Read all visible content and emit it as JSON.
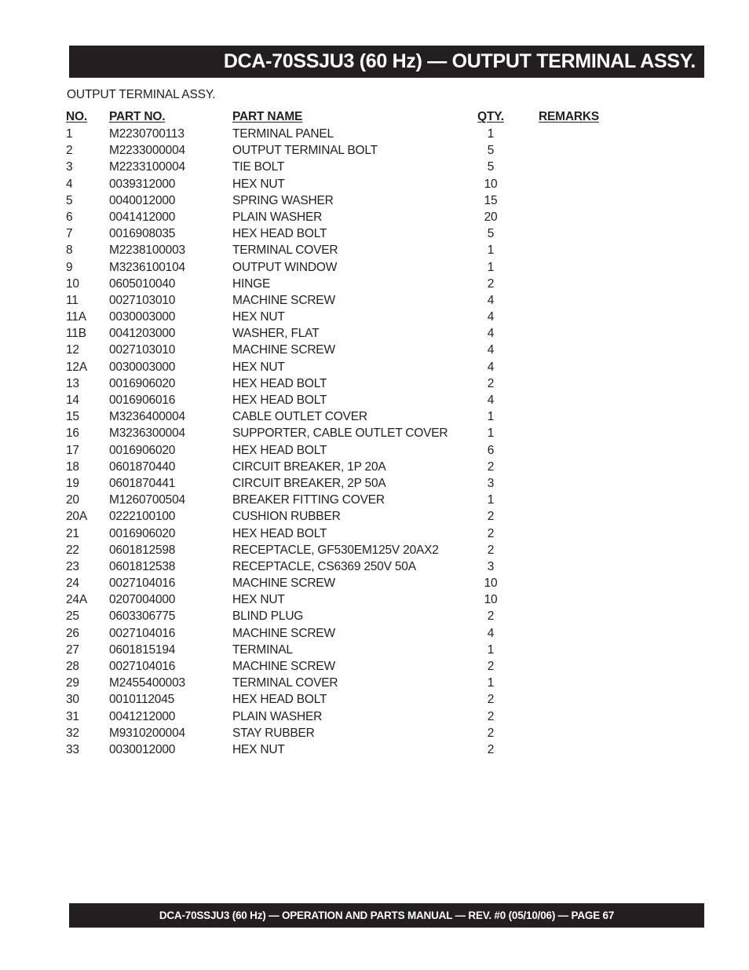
{
  "header": {
    "title": "DCA-70SSJU3 (60 Hz) — OUTPUT TERMINAL ASSY.",
    "background_color": "#231f20",
    "text_color": "#ffffff"
  },
  "section": {
    "title": "OUTPUT TERMINAL ASSY."
  },
  "table": {
    "columns": {
      "no": "NO.",
      "part_no": "PART NO.",
      "part_name": "PART NAME",
      "qty": "QTY.",
      "remarks": "REMARKS"
    },
    "rows": [
      {
        "no": "1",
        "part_no": "M2230700113",
        "part_name": "TERMINAL PANEL",
        "qty": "1",
        "remarks": ""
      },
      {
        "no": "2",
        "part_no": "M2233000004",
        "part_name": "OUTPUT TERMINAL BOLT",
        "qty": "5",
        "remarks": ""
      },
      {
        "no": "3",
        "part_no": "M2233100004",
        "part_name": "TIE BOLT",
        "qty": "5",
        "remarks": ""
      },
      {
        "no": "4",
        "part_no": "0039312000",
        "part_name": "HEX NUT",
        "qty": "10",
        "remarks": ""
      },
      {
        "no": "5",
        "part_no": "0040012000",
        "part_name": "SPRING WASHER",
        "qty": "15",
        "remarks": ""
      },
      {
        "no": "6",
        "part_no": "0041412000",
        "part_name": "PLAIN WASHER",
        "qty": "20",
        "remarks": ""
      },
      {
        "no": "7",
        "part_no": "0016908035",
        "part_name": "HEX HEAD BOLT",
        "qty": "5",
        "remarks": ""
      },
      {
        "no": "8",
        "part_no": "M2238100003",
        "part_name": "TERMINAL COVER",
        "qty": "1",
        "remarks": ""
      },
      {
        "no": "9",
        "part_no": "M3236100104",
        "part_name": "OUTPUT WINDOW",
        "qty": "1",
        "remarks": ""
      },
      {
        "no": "10",
        "part_no": "0605010040",
        "part_name": "HINGE",
        "qty": "2",
        "remarks": ""
      },
      {
        "no": "11",
        "part_no": "0027103010",
        "part_name": "MACHINE SCREW",
        "qty": "4",
        "remarks": ""
      },
      {
        "no": "11A",
        "part_no": "0030003000",
        "part_name": "HEX NUT",
        "qty": "4",
        "remarks": ""
      },
      {
        "no": "11B",
        "part_no": "0041203000",
        "part_name": "WASHER, FLAT",
        "qty": "4",
        "remarks": ""
      },
      {
        "no": "12",
        "part_no": "0027103010",
        "part_name": "MACHINE SCREW",
        "qty": "4",
        "remarks": ""
      },
      {
        "no": "12A",
        "part_no": "0030003000",
        "part_name": "HEX NUT",
        "qty": "4",
        "remarks": ""
      },
      {
        "no": "13",
        "part_no": "0016906020",
        "part_name": "HEX HEAD BOLT",
        "qty": "2",
        "remarks": ""
      },
      {
        "no": "14",
        "part_no": "0016906016",
        "part_name": "HEX HEAD BOLT",
        "qty": "4",
        "remarks": ""
      },
      {
        "no": "15",
        "part_no": "M3236400004",
        "part_name": "CABLE OUTLET COVER",
        "qty": "1",
        "remarks": ""
      },
      {
        "no": "16",
        "part_no": "M3236300004",
        "part_name": "SUPPORTER, CABLE OUTLET COVER",
        "qty": "1",
        "remarks": ""
      },
      {
        "no": "17",
        "part_no": "0016906020",
        "part_name": "HEX HEAD BOLT",
        "qty": "6",
        "remarks": ""
      },
      {
        "no": "18",
        "part_no": "0601870440",
        "part_name": "CIRCUIT BREAKER, 1P 20A",
        "qty": "2",
        "remarks": ""
      },
      {
        "no": "19",
        "part_no": "0601870441",
        "part_name": "CIRCUIT BREAKER, 2P 50A",
        "qty": "3",
        "remarks": ""
      },
      {
        "no": "20",
        "part_no": "M1260700504",
        "part_name": "BREAKER FITTING COVER",
        "qty": "1",
        "remarks": ""
      },
      {
        "no": "20A",
        "part_no": "0222100100",
        "part_name": "CUSHION RUBBER",
        "qty": "2",
        "remarks": ""
      },
      {
        "no": "21",
        "part_no": "0016906020",
        "part_name": "HEX HEAD BOLT",
        "qty": "2",
        "remarks": ""
      },
      {
        "no": "22",
        "part_no": "0601812598",
        "part_name": "RECEPTACLE, GF530EM125V 20AX2",
        "qty": "2",
        "remarks": ""
      },
      {
        "no": "23",
        "part_no": "0601812538",
        "part_name": "RECEPTACLE, CS6369 250V 50A",
        "qty": "3",
        "remarks": ""
      },
      {
        "no": "24",
        "part_no": "0027104016",
        "part_name": "MACHINE SCREW",
        "qty": "10",
        "remarks": ""
      },
      {
        "no": "24A",
        "part_no": "0207004000",
        "part_name": "HEX NUT",
        "qty": "10",
        "remarks": ""
      },
      {
        "no": "25",
        "part_no": "0603306775",
        "part_name": "BLIND PLUG",
        "qty": "2",
        "remarks": ""
      },
      {
        "no": "26",
        "part_no": "0027104016",
        "part_name": "MACHINE SCREW",
        "qty": "4",
        "remarks": ""
      },
      {
        "no": "27",
        "part_no": "0601815194",
        "part_name": "TERMINAL",
        "qty": "1",
        "remarks": ""
      },
      {
        "no": "28",
        "part_no": "0027104016",
        "part_name": "MACHINE SCREW",
        "qty": "2",
        "remarks": ""
      },
      {
        "no": "29",
        "part_no": "M2455400003",
        "part_name": "TERMINAL COVER",
        "qty": "1",
        "remarks": ""
      },
      {
        "no": "30",
        "part_no": "0010112045",
        "part_name": "HEX HEAD BOLT",
        "qty": "2",
        "remarks": ""
      },
      {
        "no": "31",
        "part_no": "0041212000",
        "part_name": "PLAIN WASHER",
        "qty": "2",
        "remarks": ""
      },
      {
        "no": "32",
        "part_no": "M9310200004",
        "part_name": "STAY RUBBER",
        "qty": "2",
        "remarks": ""
      },
      {
        "no": "33",
        "part_no": "0030012000",
        "part_name": "HEX NUT",
        "qty": "2",
        "remarks": ""
      }
    ]
  },
  "footer": {
    "text": "DCA-70SSJU3 (60 Hz) — OPERATION AND PARTS MANUAL — REV. #0  (05/10/06) — PAGE 67",
    "background_color": "#231f20",
    "text_color": "#ffffff"
  }
}
